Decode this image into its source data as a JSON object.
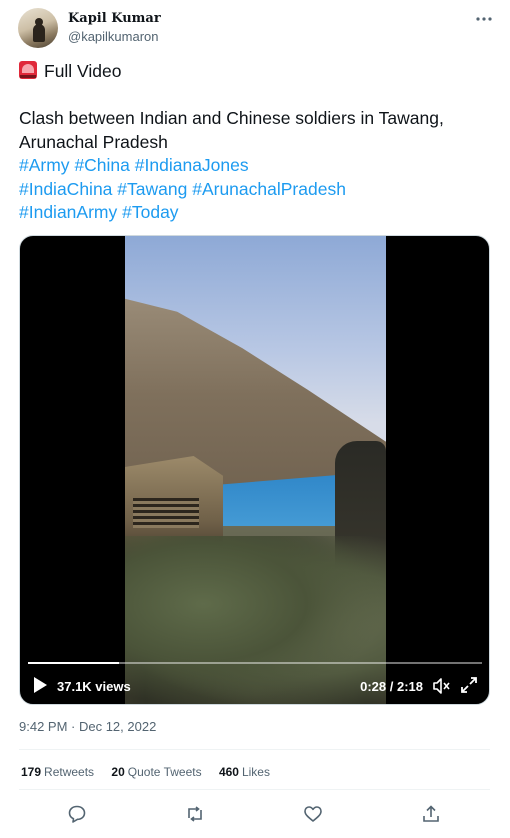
{
  "author": {
    "name": "Kapil Kumar",
    "handle": "@kapilkumaron",
    "more_icon": "more-horizontal-icon"
  },
  "tweet": {
    "emoji_icon": "siren-icon",
    "line1": "Full Video",
    "line2": "Clash between Indian and Chinese soldiers in Tawang,",
    "line3": "Arunachal Pradesh",
    "hashtags_line1": [
      "#Army",
      "#China",
      "#IndianaJones"
    ],
    "hashtags_line2": [
      "#IndiaChina",
      "#Tawang",
      "#ArunachalPradesh"
    ],
    "hashtags_line3": [
      "#IndianArmy",
      "#Today"
    ]
  },
  "video": {
    "views": "37.1K views",
    "time": "0:28 / 2:18",
    "progress": 0.2
  },
  "timestamp": "9:42 PM · Dec 12, 2022",
  "stats": {
    "retweets_count": "179",
    "retweets_label": "Retweets",
    "quotes_count": "20",
    "quotes_label": "Quote Tweets",
    "likes_count": "460",
    "likes_label": "Likes"
  },
  "colors": {
    "link": "#1d9bf0",
    "muted": "#536471",
    "text": "#0f1419"
  },
  "actions": [
    "reply-icon",
    "retweet-icon",
    "like-icon",
    "share-icon"
  ]
}
